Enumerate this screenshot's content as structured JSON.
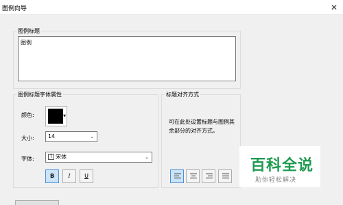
{
  "window": {
    "title": "图例向导",
    "close_glyph": "✕"
  },
  "legend_title": {
    "group_label": "图例标题",
    "value": "图例"
  },
  "font_props": {
    "group_label": "图例标题字体属性",
    "color_label": "颜色:",
    "color_value": "#000000",
    "size_label": "大小:",
    "size_value": "14",
    "font_label": "字体:",
    "font_value": "宋体",
    "bold_label": "B",
    "italic_label": "I",
    "underline_label": "U"
  },
  "alignment": {
    "group_label": "标题对齐方式",
    "description": "可在此处设置标题与图例其余部分的对齐方式。"
  },
  "watermark": {
    "main": "百科全说",
    "sub": "助你轻松解决"
  }
}
